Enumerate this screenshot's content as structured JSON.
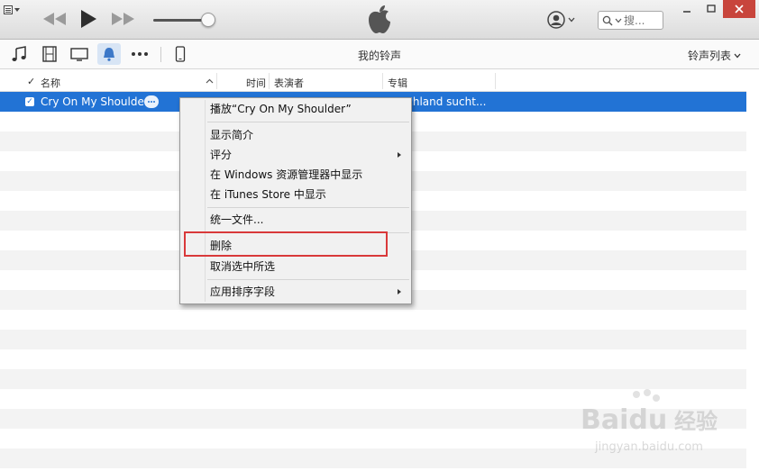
{
  "search": {
    "placeholder": "搜..."
  },
  "toolbar": {
    "title": "我的铃声",
    "view_menu": "铃声列表"
  },
  "columns": {
    "check": "✓",
    "name": "名称",
    "time": "时间",
    "artist": "表演者",
    "album": "专辑"
  },
  "selected_row": {
    "name": "Cry On My Shoulder",
    "album": "schland sucht..."
  },
  "context_menu": {
    "play": "播放“Cry On My Shoulder”",
    "get_info": "显示简介",
    "rating": "评分",
    "show_in_explorer": "在 Windows 资源管理器中显示",
    "show_in_store": "在 iTunes Store 中显示",
    "consolidate": "统一文件...",
    "delete": "删除",
    "uncheck_selection": "取消选中所选",
    "apply_sort_field": "应用排序字段"
  },
  "watermark": {
    "brand": "Baidu",
    "brand_cn": "经验",
    "url": "jingyan.baidu.com"
  },
  "colors": {
    "selection": "#2273d5",
    "highlight_box": "#d9393a",
    "close_button": "#c8453c"
  },
  "icons": [
    "menu-icon",
    "rewind-icon",
    "play-icon",
    "fast-forward-icon",
    "apple-logo-icon",
    "account-icon",
    "search-icon",
    "minimize-icon",
    "maximize-icon",
    "close-icon",
    "music-icon",
    "film-icon",
    "tv-icon",
    "ringtone-bell-icon",
    "more-icon",
    "iphone-icon",
    "chevron-down-icon",
    "submenu-arrow-icon",
    "ellipsis-icon"
  ]
}
